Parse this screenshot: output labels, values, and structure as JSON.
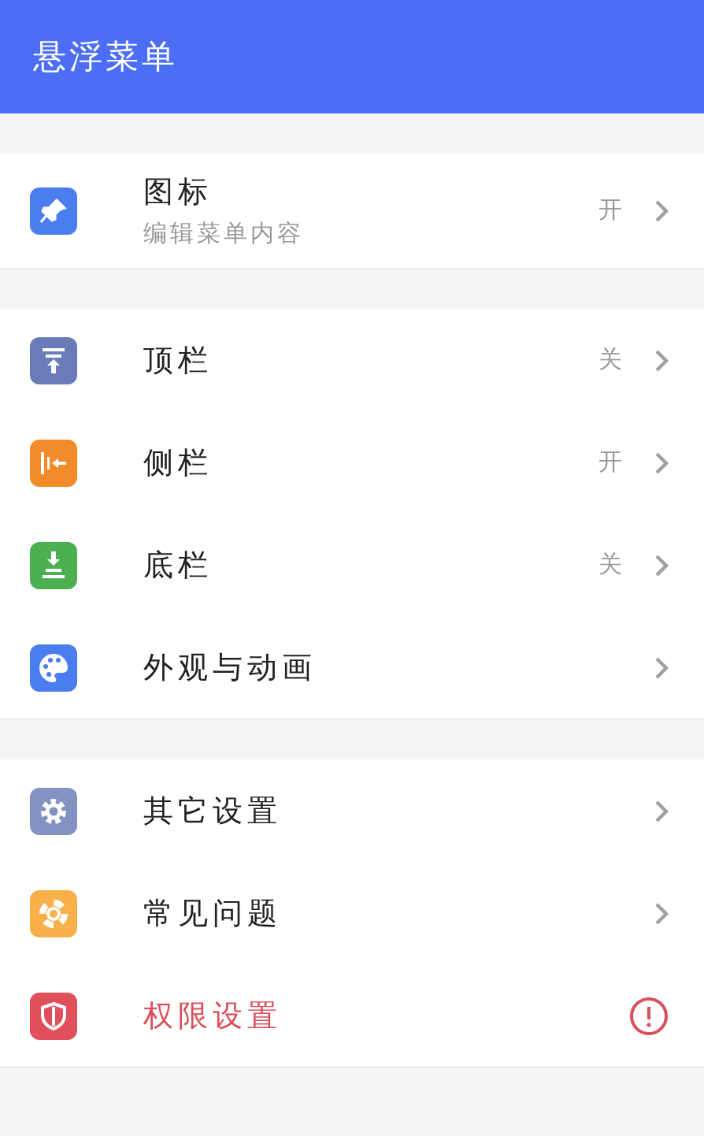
{
  "header": {
    "title": "悬浮菜单"
  },
  "sections": [
    {
      "items": [
        {
          "kind": "pin",
          "color": "#4a7df0",
          "title": "图标",
          "subtitle": "编辑菜单内容",
          "value": "开",
          "warning": false
        }
      ]
    },
    {
      "items": [
        {
          "kind": "top",
          "color": "#6a7cb8",
          "title": "顶栏",
          "value": "关",
          "warning": false
        },
        {
          "kind": "side",
          "color": "#f28c2b",
          "title": "侧栏",
          "value": "开",
          "warning": false
        },
        {
          "kind": "bottom",
          "color": "#4cb050",
          "title": "底栏",
          "value": "关",
          "warning": false
        },
        {
          "kind": "palette",
          "color": "#4a7df0",
          "title": "外观与动画",
          "warning": false
        }
      ]
    },
    {
      "items": [
        {
          "kind": "gear",
          "color": "#8293c2",
          "title": "其它设置",
          "warning": false
        },
        {
          "kind": "lifebuoy",
          "color": "#f8b14a",
          "title": "常见问题",
          "warning": false
        },
        {
          "kind": "shield",
          "color": "#e0505a",
          "title": "权限设置",
          "warning": true
        }
      ]
    }
  ]
}
